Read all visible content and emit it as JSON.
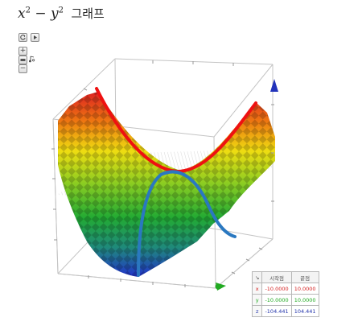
{
  "title": {
    "var_x": "x",
    "exp_x": "2",
    "minus": "−",
    "var_y": "y",
    "exp_y": "2",
    "korean": "그래프"
  },
  "controls": {
    "reset_icon": "reset-icon",
    "play_icon": "play-icon",
    "zoom_in": "+",
    "zoom_out": "−",
    "view_icon": "view-icon",
    "style_icon": "style-icon"
  },
  "colors": {
    "x": "#d42020",
    "y": "#22aa22",
    "z": "#2233aa",
    "curve_red": "#ee1111",
    "curve_blue": "#2a78c0"
  },
  "range_table": {
    "corner": "↘",
    "headers": [
      "시작점",
      "끝점"
    ],
    "rows": [
      {
        "axis": "x",
        "start": "-10.0000",
        "end": "10.0000"
      },
      {
        "axis": "y",
        "start": "-10.0000",
        "end": "10.0000"
      },
      {
        "axis": "z",
        "start": "-104.441",
        "end": "104.441"
      }
    ]
  },
  "chart_data": {
    "type": "surface3d",
    "function": "x^2 - y^2",
    "x_range": [
      -10,
      10
    ],
    "y_range": [
      -10,
      10
    ],
    "z_range": [
      -104.441,
      104.441
    ]
  }
}
